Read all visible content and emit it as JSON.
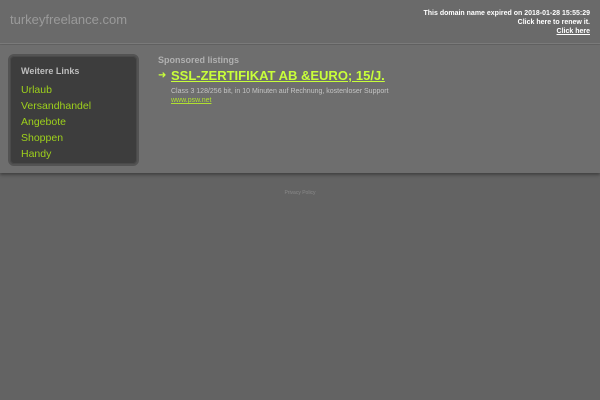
{
  "header": {
    "domain": "turkeyfreelance.com",
    "expired_line": "This domain name expired on 2018-01-28 15:55:29",
    "renew_line": "Click here to renew it.",
    "click_here": "Click here"
  },
  "sidebar": {
    "heading": "Weitere Links",
    "items": [
      "Urlaub",
      "Versandhandel",
      "Angebote",
      "Shoppen",
      "Handy"
    ]
  },
  "sponsored": {
    "heading": "Sponsored listings",
    "listing": {
      "title": "SSL-ZERTIFIKAT AB &EURO; 15/J.",
      "description": "Class 3 128/256 bit, in 10 Minuten auf Rechnung, kostenloser Support",
      "url": "www.psw.net"
    }
  },
  "footer": {
    "link": "Privacy Policy"
  },
  "colors": {
    "background": "#636363",
    "link_green": "#9ed11c",
    "title_green": "#c8ff3a"
  }
}
